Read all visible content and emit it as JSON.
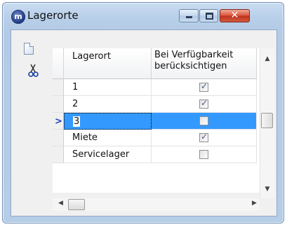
{
  "window": {
    "title": "Lagerorte",
    "app_icon_letter": "m"
  },
  "titlebar_controls": {
    "minimize": "minimize",
    "maximize": "maximize",
    "close": "✕"
  },
  "toolbar": {
    "new_icon": "new-document-icon",
    "cut_icon": "scissors-icon"
  },
  "grid": {
    "columns": [
      "Lagerort",
      "Bei Verfügbarkeit berücksichtigen"
    ],
    "column_b_line1": "Bei Verfügbarkeit",
    "column_b_line2": "berücksichtigen",
    "rows": [
      {
        "name": "1",
        "checked": true
      },
      {
        "name": "2",
        "checked": true
      },
      {
        "name": "3",
        "checked": false,
        "selected": true
      },
      {
        "name": "Miete",
        "checked": true
      },
      {
        "name": "Servicelager",
        "checked": false
      }
    ],
    "row_indicator": "current-row-arrow"
  }
}
